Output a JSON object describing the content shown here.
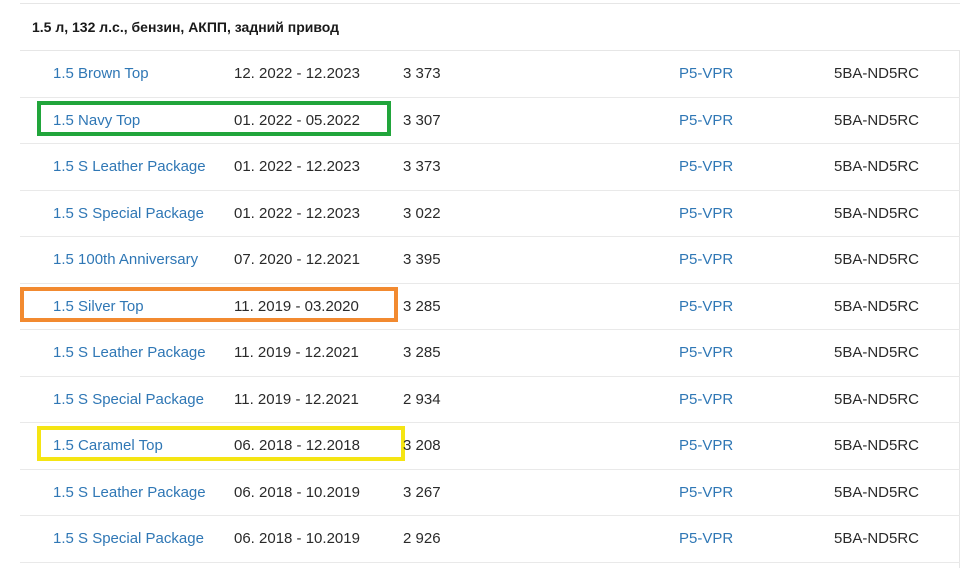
{
  "section": {
    "title": "1.5 л, 132 л.с., бензин, АКПП, задний привод"
  },
  "rows": [
    {
      "name": "1.5 Brown Top",
      "dates": "12. 2022  -  12.2023",
      "cc": "3 373",
      "engine": "P5-VPR",
      "code": "5BA-ND5RC",
      "highlight": null
    },
    {
      "name": "1.5 Navy Top",
      "dates": "01. 2022  -  05.2022",
      "cc": "3 307",
      "engine": "P5-VPR",
      "code": "5BA-ND5RC",
      "highlight": "#21a53b"
    },
    {
      "name": "1.5 S Leather Package",
      "dates": "01. 2022  -  12.2023",
      "cc": "3 373",
      "engine": "P5-VPR",
      "code": "5BA-ND5RC",
      "highlight": null
    },
    {
      "name": "1.5 S Special Package",
      "dates": "01. 2022  -  12.2023",
      "cc": "3 022",
      "engine": "P5-VPR",
      "code": "5BA-ND5RC",
      "highlight": null
    },
    {
      "name": "1.5 100th Anniversary",
      "dates": "07. 2020  -  12.2021",
      "cc": "3 395",
      "engine": "P5-VPR",
      "code": "5BA-ND5RC",
      "highlight": null
    },
    {
      "name": "1.5 Silver Top",
      "dates": "11. 2019  -  03.2020",
      "cc": "3 285",
      "engine": "P5-VPR",
      "code": "5BA-ND5RC",
      "highlight": "#f28a30"
    },
    {
      "name": "1.5 S Leather Package",
      "dates": "11. 2019  -  12.2021",
      "cc": "3 285",
      "engine": "P5-VPR",
      "code": "5BA-ND5RC",
      "highlight": null
    },
    {
      "name": "1.5 S Special Package",
      "dates": "11. 2019  -  12.2021",
      "cc": "2 934",
      "engine": "P5-VPR",
      "code": "5BA-ND5RC",
      "highlight": null
    },
    {
      "name": "1.5 Caramel Top",
      "dates": "06. 2018  -  12.2018",
      "cc": "3 208",
      "engine": "P5-VPR",
      "code": "5BA-ND5RC",
      "highlight": "#f5e513"
    },
    {
      "name": "1.5 S Leather Package",
      "dates": "06. 2018  -  10.2019",
      "cc": "3 267",
      "engine": "P5-VPR",
      "code": "5BA-ND5RC",
      "highlight": null
    },
    {
      "name": "1.5 S Special Package",
      "dates": "06. 2018  -  10.2019",
      "cc": "2 926",
      "engine": "P5-VPR",
      "code": "5BA-ND5RC",
      "highlight": null
    }
  ],
  "colors": {
    "link": "#2f77b5",
    "text": "#2a2a2a",
    "divider": "#e9e9e9"
  }
}
